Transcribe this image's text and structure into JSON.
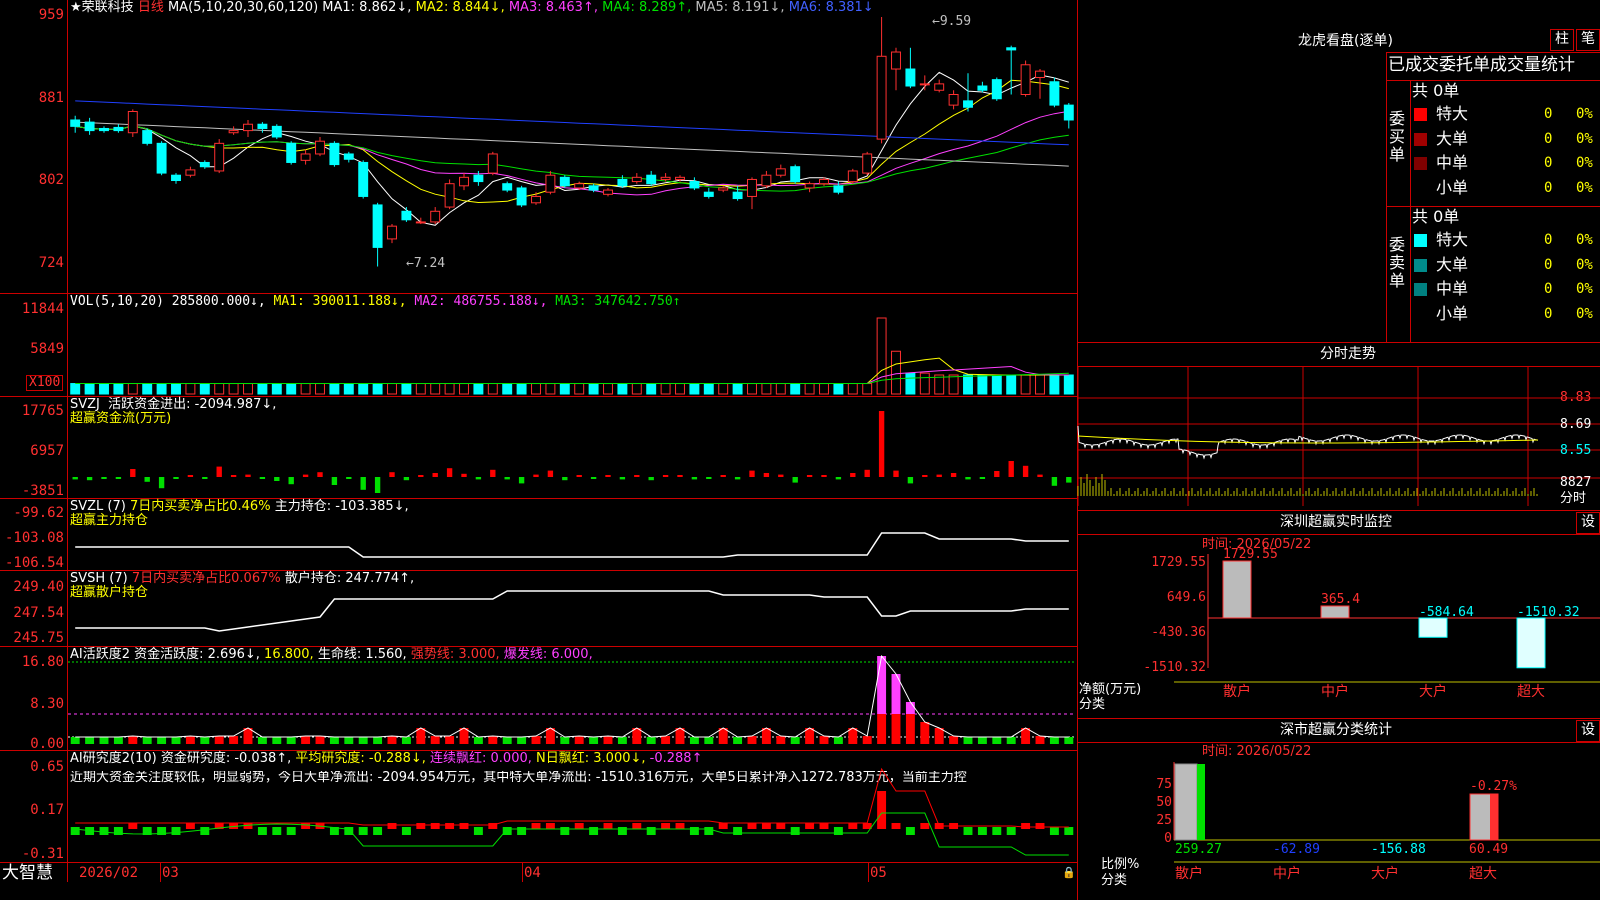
{
  "header": {
    "stock_name": "荣联科技",
    "period": "日线",
    "ma_label": "MA(5,10,20,30,60,120)",
    "ma1": "MA1: 8.862↓,",
    "ma2": "MA2: 8.844↓,",
    "ma3": "MA3: 8.463↑,",
    "ma4": "MA4: 8.289↑,",
    "ma5": "MA5: 8.191↓,",
    "ma6": "MA6: 8.381↓",
    "high_note": "9.59",
    "low_note": "7.24"
  },
  "price_axis": [
    "959",
    "881",
    "802",
    "724"
  ],
  "vol": {
    "label": "VOL(5,10,20)",
    "value": "285800.000↓,",
    "ma1": "MA1: 390011.188↓,",
    "ma2": "MA2: 486755.188↓,",
    "ma3": "MA3: 347642.750↑",
    "axis": [
      "11844",
      "5849"
    ],
    "unit": "X100"
  },
  "svzj": {
    "label": "SVZJ",
    "desc": "活跃资金进出: -2094.987↓,",
    "title": "超赢资金流(万元)",
    "axis": [
      "17765",
      "6957",
      "-3851"
    ]
  },
  "svzl": {
    "label": "SVZL (7)",
    "desc1": "7日内买卖净占比0.46%",
    "desc2": "主力持仓: -103.385↓,",
    "title": "超赢主力持仓",
    "axis": [
      "-99.62",
      "-103.08",
      "-106.54"
    ]
  },
  "svsh": {
    "label": "SVSH (7)",
    "desc1": "7日内买卖净占比0.067%",
    "desc2": "散户持仓: 247.774↑,",
    "title": "超赢散户持仓",
    "axis": [
      "249.40",
      "247.54",
      "245.75"
    ]
  },
  "ai1": {
    "label": "AI活跃度2",
    "desc": "资金活跃度: 2.696↓,",
    "v1": "16.800,",
    "v2": "生命线: 1.560,",
    "v3": "强势线: 3.000,",
    "v4": "爆发线: 6.000,",
    "axis": [
      "16.80",
      "8.30",
      "0.00"
    ]
  },
  "ai2": {
    "label": "AI研究度2(10)",
    "desc1": "资金研究度: -0.038↑,",
    "desc2": "平均研究度: -0.288↓,",
    "desc3": "连续飘红: 0.000,",
    "desc4": "N日飘红: 3.000↓,",
    "desc5": "-0.288↑",
    "note": "近期大资金关注度较低，明显弱势，今日大单净流出: -2094.954万元，其中特大单净流出: -1510.316万元，大单5日累计净入1272.783万元，当前主力控",
    "axis": [
      "0.65",
      "0.17",
      "-0.31"
    ]
  },
  "timeline": {
    "brand": "大智慧",
    "labels": [
      "2026/02",
      "03",
      "04",
      "05"
    ]
  },
  "lhb": {
    "title": "龙虎看盘(逐单)",
    "btn1": "柱",
    "btn2": "笔",
    "tabs": "已成交委托单成交量统计",
    "buy_side": "委买单",
    "sell_side": "委卖单",
    "buy_total": "共 0单",
    "sell_total": "共 0单",
    "rows": [
      "特大",
      "大单",
      "中单",
      "小单"
    ],
    "zero": "0",
    "pct": "0%",
    "buy_colors": [
      "#ff0000",
      "#a00000",
      "#800000",
      "#000000"
    ],
    "sell_colors": [
      "#00ffff",
      "#008b8b",
      "#008080",
      "#000000"
    ]
  },
  "intraday": {
    "title": "分时走势",
    "axis": [
      "8.83",
      "8.69",
      "8.55"
    ],
    "vol": "8827",
    "unit": "分时"
  },
  "sz_monitor": {
    "title": "深圳超赢实时监控",
    "set": "设",
    "time": "时间: 2026/05/22",
    "axis": [
      "1729.55",
      "649.6",
      "-430.36",
      "-1510.32"
    ],
    "bars": [
      {
        "label": "散户",
        "value": 1729.55,
        "text": "1729.55"
      },
      {
        "label": "中户",
        "value": 365.4,
        "text": "365.4"
      },
      {
        "label": "大户",
        "value": -584.64,
        "text": "-584.64"
      },
      {
        "label": "超大",
        "value": -1510.32,
        "text": "-1510.32"
      }
    ],
    "ylabel1": "净额(万元)",
    "ylabel2": "分类"
  },
  "sz_class": {
    "title": "深市超赢分类统计",
    "set": "设",
    "time": "时间: 2026/05/22",
    "axis": [
      "75",
      "50",
      "25",
      "0"
    ],
    "top_label": "-0.27%",
    "values": [
      "259.27",
      "-62.89",
      "-156.88",
      "60.49"
    ],
    "labels": [
      "散户",
      "中户",
      "大户",
      "超大"
    ],
    "ylabel1": "比例%",
    "ylabel2": "分类"
  },
  "chart_data": {
    "type": "candlestick",
    "ylim": [
      7.24,
      9.59
    ],
    "candles": [
      [
        8.62,
        8.56,
        8.5,
        8.66
      ],
      [
        8.6,
        8.52,
        8.48,
        8.64
      ],
      [
        8.54,
        8.52,
        8.5,
        8.56
      ],
      [
        8.55,
        8.52,
        8.5,
        8.58
      ],
      [
        8.5,
        8.7,
        8.46,
        8.72
      ],
      [
        8.52,
        8.4,
        8.38,
        8.54
      ],
      [
        8.4,
        8.12,
        8.1,
        8.42
      ],
      [
        8.1,
        8.05,
        8.02,
        8.12
      ],
      [
        8.1,
        8.15,
        8.08,
        8.18
      ],
      [
        8.22,
        8.18,
        8.16,
        8.24
      ],
      [
        8.14,
        8.4,
        8.12,
        8.44
      ],
      [
        8.5,
        8.52,
        8.48,
        8.56
      ],
      [
        8.52,
        8.58,
        8.46,
        8.62
      ],
      [
        8.58,
        8.54,
        8.5,
        8.6
      ],
      [
        8.56,
        8.46,
        8.44,
        8.58
      ],
      [
        8.4,
        8.22,
        8.2,
        8.42
      ],
      [
        8.24,
        8.3,
        8.2,
        8.34
      ],
      [
        8.3,
        8.42,
        8.28,
        8.46
      ],
      [
        8.4,
        8.2,
        8.18,
        8.42
      ],
      [
        8.3,
        8.25,
        8.22,
        8.32
      ],
      [
        8.22,
        7.9,
        7.88,
        8.24
      ],
      [
        7.82,
        7.42,
        7.24,
        7.84
      ],
      [
        7.5,
        7.62,
        7.46,
        7.64
      ],
      [
        7.76,
        7.68,
        7.66,
        7.8
      ],
      [
        7.66,
        7.66,
        7.64,
        7.7
      ],
      [
        7.66,
        7.76,
        7.64,
        7.8
      ],
      [
        7.8,
        8.02,
        7.78,
        8.06
      ],
      [
        8.0,
        8.08,
        7.96,
        8.12
      ],
      [
        8.1,
        8.04,
        8.0,
        8.14
      ],
      [
        8.12,
        8.3,
        8.1,
        8.32
      ],
      [
        8.02,
        7.96,
        7.94,
        8.04
      ],
      [
        7.98,
        7.82,
        7.8,
        8.0
      ],
      [
        7.84,
        7.9,
        7.82,
        7.94
      ],
      [
        7.94,
        8.1,
        7.92,
        8.14
      ],
      [
        8.08,
        8.0,
        7.98,
        8.1
      ],
      [
        7.98,
        8.02,
        7.96,
        8.04
      ],
      [
        8.0,
        7.96,
        7.94,
        8.02
      ],
      [
        7.92,
        7.96,
        7.9,
        7.98
      ],
      [
        8.06,
        8.0,
        7.98,
        8.1
      ],
      [
        8.04,
        8.08,
        8.02,
        8.12
      ],
      [
        8.1,
        8.02,
        8.0,
        8.14
      ],
      [
        8.06,
        8.08,
        8.04,
        8.12
      ],
      [
        8.06,
        8.08,
        8.04,
        8.1
      ],
      [
        8.04,
        7.98,
        7.96,
        8.08
      ],
      [
        7.94,
        7.9,
        7.88,
        7.98
      ],
      [
        7.96,
        7.98,
        7.94,
        8.0
      ],
      [
        7.94,
        7.88,
        7.86,
        8.0
      ],
      [
        7.9,
        8.06,
        7.78,
        8.08
      ],
      [
        8.0,
        8.1,
        7.98,
        8.14
      ],
      [
        8.1,
        8.16,
        8.08,
        8.2
      ],
      [
        8.18,
        8.04,
        8.02,
        8.2
      ],
      [
        7.98,
        8.02,
        7.94,
        8.04
      ],
      [
        8.02,
        8.06,
        8.0,
        8.08
      ],
      [
        8.0,
        7.94,
        7.92,
        8.04
      ],
      [
        8.04,
        8.14,
        8.02,
        8.16
      ],
      [
        8.12,
        8.3,
        8.1,
        8.32
      ],
      [
        8.44,
        9.22,
        8.4,
        9.59
      ],
      [
        9.1,
        9.26,
        8.9,
        9.3
      ],
      [
        9.1,
        8.94,
        8.92,
        9.3
      ],
      [
        8.96,
        8.96,
        8.9,
        9.04
      ],
      [
        8.9,
        8.96,
        8.88,
        9.0
      ],
      [
        8.76,
        8.86,
        8.72,
        8.9
      ],
      [
        8.8,
        8.74,
        8.7,
        9.06
      ],
      [
        8.94,
        8.9,
        8.88,
        8.98
      ],
      [
        9.0,
        8.82,
        8.8,
        9.02
      ],
      [
        9.3,
        9.28,
        8.86,
        9.32
      ],
      [
        8.86,
        9.14,
        8.84,
        9.18
      ],
      [
        9.02,
        9.08,
        8.82,
        9.1
      ],
      [
        8.98,
        8.76,
        8.74,
        9.02
      ],
      [
        8.76,
        8.62,
        8.54,
        8.78
      ]
    ]
  }
}
